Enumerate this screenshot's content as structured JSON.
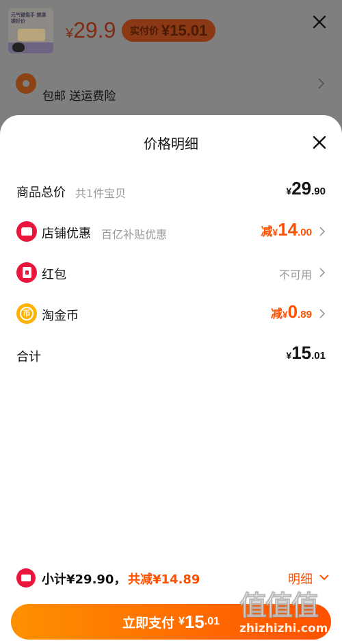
{
  "background": {
    "product_thumb_text": "元气键盘手 搓搓搓好价",
    "price_yen": "¥",
    "price": "29.9",
    "pay_badge_label": "实付价",
    "pay_badge_value": "¥15.01",
    "shipping_text": "包邮  送运费险"
  },
  "sheet": {
    "title": "价格明细",
    "rows": [
      {
        "label": "商品总价",
        "sub": "共1件宝贝",
        "yen": "¥",
        "int": "29",
        "dec": ".90"
      },
      {
        "label": "店铺优惠",
        "sub": "百亿补贴优惠",
        "prefix": "减",
        "yen": "¥",
        "int": "14",
        "dec": ".00"
      },
      {
        "label": "红包",
        "status": "不可用"
      },
      {
        "label": "淘金币",
        "prefix": "减",
        "yen": "¥",
        "int": "0",
        "dec": ".89",
        "coin_glyph": "币"
      },
      {
        "label": "合计",
        "yen": "¥",
        "int": "15",
        "dec": ".01"
      }
    ]
  },
  "footer": {
    "subtotal": "小计¥29.90，",
    "reduce": "共减¥14.89",
    "detail": "明细"
  },
  "pay_button": {
    "label": "立即支付",
    "yen": "¥",
    "int": "15",
    "dec": ".01"
  },
  "watermark": {
    "big": "值值值",
    "small": "zhizhizhi.com"
  },
  "colors": {
    "accent": "#ff5000",
    "accent_start": "#ff9000",
    "red_icon": "#e8173b",
    "coin_icon": "#ffb300",
    "muted_text": "#999999"
  }
}
